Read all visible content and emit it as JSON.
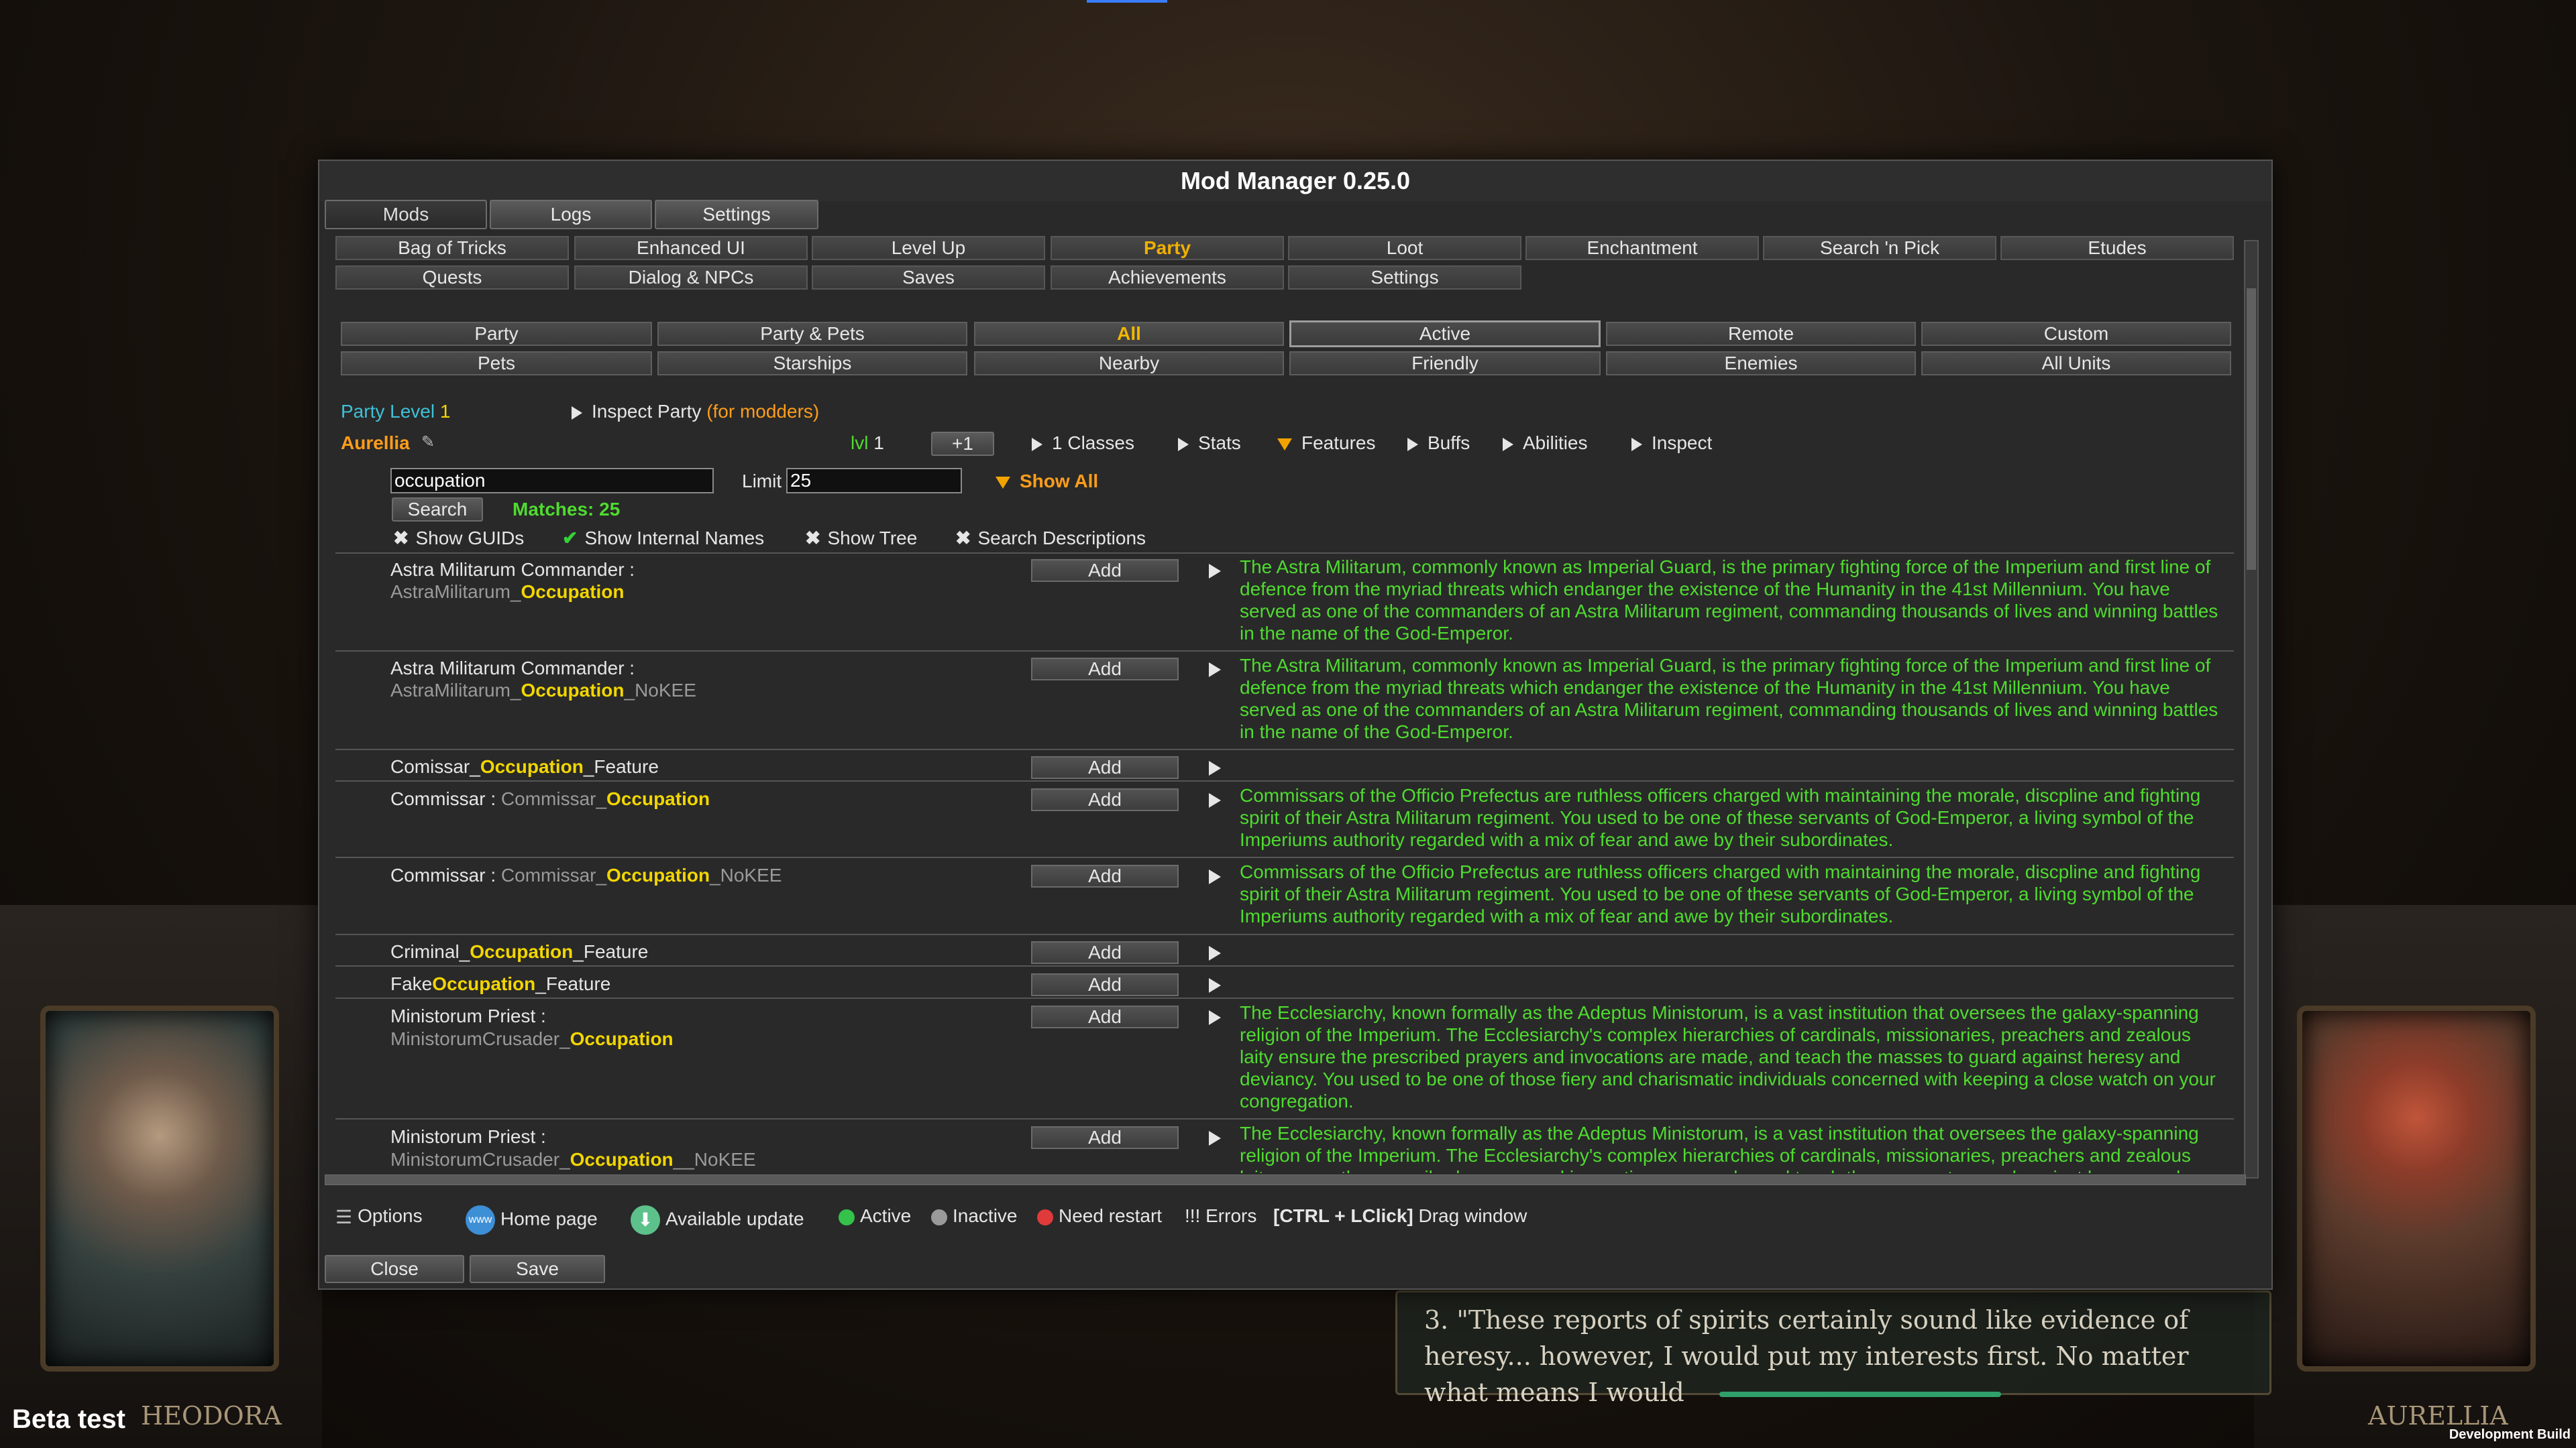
{
  "window": {
    "title": "Mod Manager 0.25.0"
  },
  "main_tabs": [
    "Mods",
    "Logs",
    "Settings"
  ],
  "feature_tabs_row1": [
    "Bag of Tricks",
    "Enhanced UI",
    "Level Up",
    "Party",
    "Loot",
    "Enchantment",
    "Search 'n Pick",
    "Etudes"
  ],
  "feature_tabs_row2": [
    "Quests",
    "Dialog & NPCs",
    "Saves",
    "Achievements",
    "Settings"
  ],
  "filters_row1": [
    "Party",
    "Party & Pets",
    "All",
    "Active",
    "Remote",
    "Custom"
  ],
  "filters_row2": [
    "Pets",
    "Starships",
    "Nearby",
    "Friendly",
    "Enemies",
    "All Units"
  ],
  "party": {
    "level_label": "Party Level",
    "level_value": "1",
    "inspect_label": "Inspect Party",
    "inspect_note": "(for modders)"
  },
  "character": {
    "name": "Aurellia",
    "lvl_label": "lvl",
    "lvl_value": "1",
    "plus_label": "+1",
    "sections": [
      "1 Classes",
      "Stats",
      "Features",
      "Buffs",
      "Abilities",
      "Inspect"
    ]
  },
  "search": {
    "query": "occupation",
    "limit_label": "Limit",
    "limit_value": "25",
    "show_all": "Show All",
    "search_button": "Search",
    "matches": "Matches: 25",
    "options": [
      "Show GUIDs",
      "Show Internal Names",
      "Show Tree",
      "Search Descriptions"
    ]
  },
  "add_label": "Add",
  "results": [
    {
      "title": "Astra Militarum Commander :",
      "sub_prefix": "AstraMilitarum_",
      "sub_hl": "Occupation",
      "sub_suffix": "",
      "desc": "The Astra Militarum, commonly known as Imperial Guard, is the primary fighting force of the Imperium and first line of defence from the myriad threats which endanger the existence of the Humanity in the 41st Millennium. You have served as one of the commanders of an Astra Militarum regiment, commanding thousands of lives and winning battles in the name of the God-Emperor."
    },
    {
      "title": "Astra Militarum Commander :",
      "sub_prefix": "AstraMilitarum_",
      "sub_hl": "Occupation",
      "sub_suffix": "_NoKEE",
      "desc": "The Astra Militarum, commonly known as Imperial Guard, is the primary fighting force of the Imperium and first line of defence from the myriad threats which endanger the existence of the Humanity in the 41st Millennium. You have served as one of the commanders of an Astra Militarum regiment, commanding thousands of lives and winning battles in the name of the God-Emperor."
    },
    {
      "inline_prefix": "Comissar_",
      "inline_hl": "Occupation",
      "inline_suffix": "_Feature"
    },
    {
      "title_inline": "Commissar : ",
      "grey_prefix": "Commissar_",
      "inline_hl": "Occupation",
      "grey_suffix": "",
      "desc": "Commissars of the Officio Prefectus are ruthless officers charged with maintaining the morale, discpline and fighting spirit of their Astra Militarum regiment. You used to be one of these servants of God-Emperor, a living symbol of the Imperiums authority regarded with a mix of fear and awe by their subordinates."
    },
    {
      "title_inline": "Commissar : ",
      "grey_prefix": "Commissar_",
      "inline_hl": "Occupation",
      "grey_suffix": "_NoKEE",
      "desc": "Commissars of the Officio Prefectus are ruthless officers charged with maintaining the morale, discpline and fighting spirit of their Astra Militarum regiment. You used to be one of these servants of God-Emperor, a living symbol of the Imperiums authority regarded with a mix of fear and awe by their subordinates."
    },
    {
      "inline_prefix": "Criminal_",
      "inline_hl": "Occupation",
      "inline_suffix": "_Feature"
    },
    {
      "inline_prefix": "Fake",
      "inline_hl": "Occupation",
      "inline_suffix": "_Feature"
    },
    {
      "title": "Ministorum Priest :",
      "sub_prefix": "MinistorumCrusader_",
      "sub_hl": "Occupation",
      "sub_suffix": "",
      "desc": "The Ecclesiarchy, known formally as the Adeptus Ministorum, is a vast institution that oversees the galaxy-spanning religion of the Imperium. The Ecclesiarchy's complex hierarchies of cardinals, missionaries, preachers and zealous laity ensure the prescribed prayers and invocations are made, and teach the masses to guard against heresy and deviancy. You used to be one of those fiery and charismatic individuals concerned with keeping a close watch on your congregation."
    },
    {
      "title": "Ministorum Priest :",
      "sub_prefix": "MinistorumCrusader_",
      "sub_hl": "Occupation",
      "sub_suffix": "__NoKEE",
      "desc": "The Ecclesiarchy, known formally as the Adeptus Ministorum, is a vast institution that oversees the galaxy-spanning religion of the Imperium. The Ecclesiarchy's complex hierarchies of cardinals, missionaries, preachers and zealous laity ensure the prescribed prayers and invocations are made, and teach the masses to guard against heresy and deviancy."
    }
  ],
  "footer": {
    "options": "Options",
    "home": "Home page",
    "update": "Available update",
    "active": "Active",
    "inactive": "Inactive",
    "restart": "Need restart",
    "errors": "!!! Errors",
    "drag_key": "[CTRL + LClick]",
    "drag_label": "Drag window",
    "close": "Close",
    "save": "Save"
  },
  "game": {
    "dialog": "3. \"These reports of spirits certainly sound like evidence of heresy... however, I would put my interests first. No matter what means I would",
    "left_name": "HEODORA",
    "right_name": "AURELLIA",
    "beta": "Beta test",
    "dev_build": "Development Build"
  },
  "colors": {
    "accent_orange": "#f0b000",
    "description_green": "#4fdb2f",
    "highlight_yellow": "#f2d600",
    "party_cyan": "#3ec1d8"
  }
}
